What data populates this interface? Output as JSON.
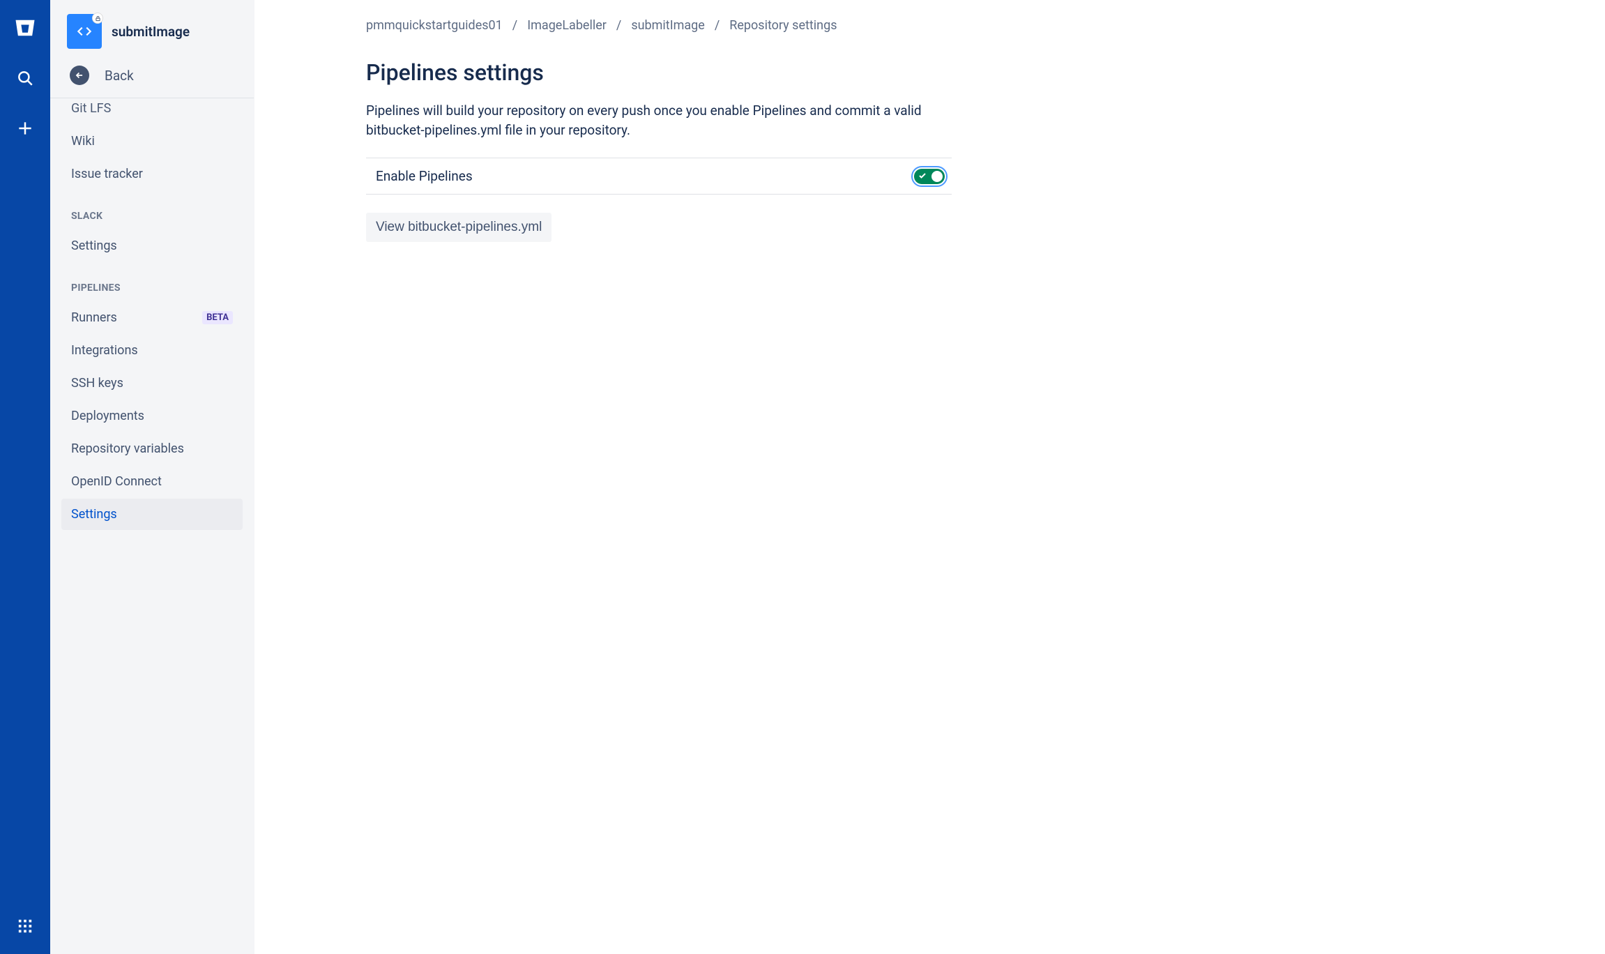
{
  "globalNav": {
    "logo": "bitbucket-logo",
    "search": "search-icon",
    "create": "plus-icon",
    "apps": "app-switcher-icon"
  },
  "sidebar": {
    "repoName": "submitImage",
    "backLabel": "Back",
    "items": [
      {
        "label": "Git LFS",
        "badge": ""
      },
      {
        "label": "Wiki",
        "badge": ""
      },
      {
        "label": "Issue tracker",
        "badge": ""
      }
    ],
    "sections": [
      {
        "title": "SLACK",
        "items": [
          {
            "label": "Settings",
            "badge": "",
            "active": false
          }
        ]
      },
      {
        "title": "PIPELINES",
        "items": [
          {
            "label": "Runners",
            "badge": "BETA",
            "active": false
          },
          {
            "label": "Integrations",
            "badge": "",
            "active": false
          },
          {
            "label": "SSH keys",
            "badge": "",
            "active": false
          },
          {
            "label": "Deployments",
            "badge": "",
            "active": false
          },
          {
            "label": "Repository variables",
            "badge": "",
            "active": false
          },
          {
            "label": "OpenID Connect",
            "badge": "",
            "active": false
          },
          {
            "label": "Settings",
            "badge": "",
            "active": true
          }
        ]
      }
    ]
  },
  "breadcrumbs": {
    "items": [
      "pmmquickstartguides01",
      "ImageLabeller",
      "submitImage",
      "Repository settings"
    ],
    "separator": "/"
  },
  "page": {
    "title": "Pipelines settings",
    "description": "Pipelines will build your repository on every push once you enable Pipelines and commit a valid bitbucket-pipelines.yml file in your repository.",
    "enableLabel": "Enable Pipelines",
    "toggleOn": true,
    "viewYmlLabel": "View bitbucket-pipelines.yml"
  }
}
